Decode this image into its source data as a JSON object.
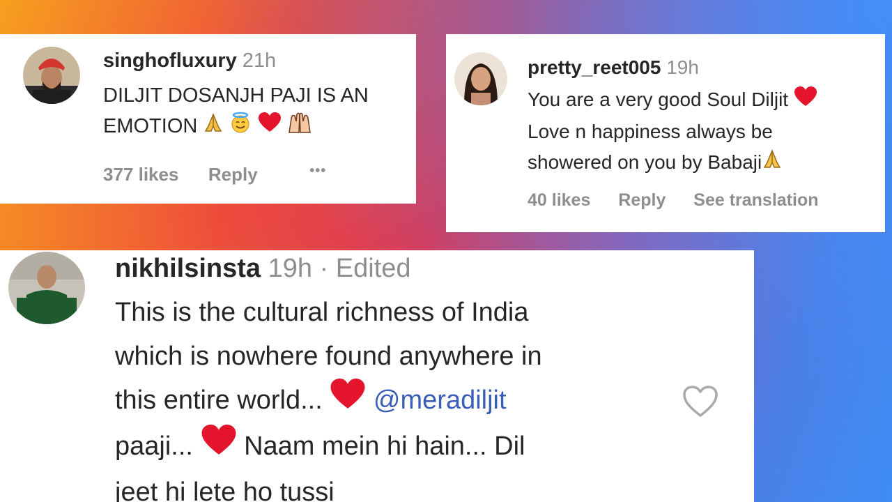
{
  "comments": [
    {
      "username": "singhofluxury",
      "time": "21h",
      "text_lines": [
        "DILJIT DOSANJH PAJI IS AN",
        "EMOTION"
      ],
      "emojis": [
        "folded-hands-icon",
        "smiling-face-with-halo-icon",
        "red-heart-icon",
        "raising-hands-icon"
      ],
      "likes": "377 likes",
      "reply": "Reply",
      "more": "•••"
    },
    {
      "username": "pretty_reet005",
      "time": "19h",
      "text_lines": [
        "You are a very good Soul Diljit",
        "Love n happiness always be",
        "showered on you by Babaji"
      ],
      "likes": "40 likes",
      "reply": "Reply",
      "see_translation": "See translation"
    },
    {
      "username": "nikhilsinsta",
      "time": "19h · Edited",
      "line1": "This is the cultural richness of India",
      "line2": "which is nowhere found anywhere in",
      "line3a": "this entire world...",
      "mention": "@meradiljit",
      "line4a": "paaji...",
      "line4b": "Naam mein hi hain... Dil",
      "line5": "jeet hi lete ho tussi"
    }
  ],
  "colors": {
    "heart": "#e4142d",
    "mention": "#3a5db7",
    "meta": "#8e8e8e",
    "text": "#262626"
  }
}
